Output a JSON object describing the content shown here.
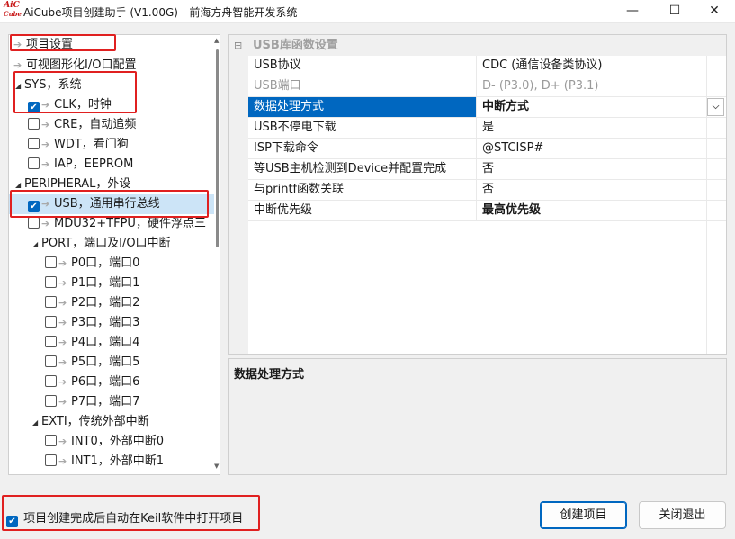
{
  "window": {
    "logo_line1": "AiC",
    "logo_line2": "Cube",
    "title": "AiCube项目创建助手 (V1.00G) --前海方舟智能开发系统--",
    "minimize": "—",
    "maximize": "☐",
    "close": "✕"
  },
  "tree": {
    "items": [
      {
        "label": "项目设置"
      },
      {
        "label": "可视图形化I/O口配置"
      },
      {
        "label": "SYS，系统"
      },
      {
        "label": "CLK，时钟"
      },
      {
        "label": "CRE，自动追频"
      },
      {
        "label": "WDT，看门狗"
      },
      {
        "label": "IAP，EEPROM"
      },
      {
        "label": "PERIPHERAL，外设"
      },
      {
        "label": "USB，通用串行总线"
      },
      {
        "label": "MDU32+TFPU，硬件浮点三"
      },
      {
        "label": "PORT，端口及I/O口中断"
      },
      {
        "label": "P0口，端口0"
      },
      {
        "label": "P1口，端口1"
      },
      {
        "label": "P2口，端口2"
      },
      {
        "label": "P3口，端口3"
      },
      {
        "label": "P4口，端口4"
      },
      {
        "label": "P5口，端口5"
      },
      {
        "label": "P6口，端口6"
      },
      {
        "label": "P7口，端口7"
      },
      {
        "label": "EXTI，传统外部中断"
      },
      {
        "label": "INT0，外部中断0"
      },
      {
        "label": "INT1，外部中断1"
      }
    ]
  },
  "property_grid": {
    "category": "USB库函数设置",
    "rows": [
      {
        "name": "USB协议",
        "value": "CDC (通信设备类协议)"
      },
      {
        "name": "USB端口",
        "value": "D- (P3.0), D+ (P3.1)"
      },
      {
        "name": "数据处理方式",
        "value": "中断方式"
      },
      {
        "name": "USB不停电下载",
        "value": "是"
      },
      {
        "name": "ISP下载命令",
        "value": "@STCISP#"
      },
      {
        "name": "等USB主机检测到Device并配置完成",
        "value": "否"
      },
      {
        "name": "与printf函数关联",
        "value": "否"
      },
      {
        "name": "中断优先级",
        "value": "最高优先级"
      }
    ]
  },
  "description": {
    "title": "数据处理方式"
  },
  "footer": {
    "auto_open_label": "项目创建完成后自动在Keil软件中打开项目",
    "create_button": "创建项目",
    "close_button": "关闭退出"
  },
  "colors": {
    "accent": "#0067c0",
    "annotation": "#e02020",
    "selection": "#cce4f7"
  }
}
